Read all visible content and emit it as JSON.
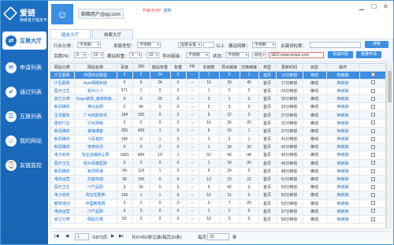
{
  "brand": {
    "name": "爱链",
    "subtitle": "换链官方指定平台"
  },
  "nav": [
    {
      "label": "互换大厅",
      "icon": "⇄",
      "active": true
    },
    {
      "label": "申请列表",
      "icon": "✉"
    },
    {
      "label": "通过列表",
      "icon": "✔"
    },
    {
      "label": "互换列表",
      "icon": "☰"
    },
    {
      "label": "我的网站",
      "icon": "⌂"
    },
    {
      "label": "友链监控",
      "icon": "⌚"
    }
  ],
  "user": {
    "email": "邮箱用户@qq.com",
    "vip_link": "升级为VIP",
    "bonus": "送购"
  },
  "tabs": [
    "链友大厅",
    "档案大厅"
  ],
  "filters": {
    "industry_label": "行业分类：",
    "industry": "不限制",
    "rank_label": "发链类型：",
    "rank": "不限制",
    "region_label": "",
    "region": "国家设置",
    "min_label": "以上",
    "outlinks_label": "搬运网数：",
    "outlinks": "不限制",
    "keyword_label": "关键词检索：",
    "keyword": "",
    "search_btn": "搜索",
    "weight_label": "百度PR：",
    "weight_from": "0",
    "weight_to": "10",
    "br_label": "搬站权重：",
    "br_from": "0",
    "br_to": "10",
    "import_label": "导出链接：",
    "import": "不限制",
    "status_label": "状态：",
    "status": "不限制",
    "site_label": "网址",
    "url_value": "SEO-www.seopz.com",
    "quick_btn": "快速匹配",
    "batch_btn": "批量申请"
  },
  "table": {
    "headers": [
      "网站分类",
      "网站名称",
      "百度",
      "360",
      "搬站权重",
      "权重",
      "PR",
      "反链数",
      "导出链接",
      "交换链接",
      "类型",
      "更新时间",
      "状态",
      "操作",
      ""
    ],
    "rows": [
      [
        "IT互联网",
        "中国商业联盟",
        "3",
        "2",
        "24",
        "0",
        "--",
        "7",
        "0",
        "1",
        "首页",
        "13分钟前",
        "离线",
        "换链接"
      ],
      [
        "IT互联网",
        "Itum网络科技",
        "0",
        "0",
        "24",
        "0",
        "--",
        "16",
        "30",
        "45",
        "首页",
        "17分钟前",
        "离线",
        "换链接"
      ],
      [
        "医疗卫生",
        "杭州人人",
        "571",
        "1",
        "0",
        "0",
        "--",
        "1",
        "0",
        "0",
        "首页",
        "23分钟前",
        "离线",
        "换链接"
      ],
      [
        "其它分类",
        "Singo装饰_装修搜索...",
        "0",
        "0",
        "25",
        "0",
        "--",
        "0",
        "1",
        "0",
        "首页",
        "25分钟前",
        "离线",
        "换链接"
      ],
      [
        "新闻媒体",
        "神马谷网",
        "2",
        "96",
        "0",
        "0",
        "--",
        "5",
        "3",
        "0",
        "首页",
        "25分钟前",
        "离线",
        "换链接"
      ],
      [
        "生活服务",
        "广州商旅资讯",
        "184",
        "155",
        "0",
        "0",
        "--",
        "9",
        "22",
        "3",
        "首页",
        "27分钟前",
        "离线",
        "换链接"
      ],
      [
        "建材行业",
        "行水网络",
        "0",
        "0",
        "0",
        "0",
        "--",
        "16",
        "36",
        "25",
        "首页",
        "31分钟前",
        "离线",
        "换链接"
      ],
      [
        "新闻媒体",
        "美柚博客",
        "355",
        "459",
        "1",
        "0",
        "--",
        "6",
        "15",
        "1",
        "首页",
        "37分钟前",
        "离线",
        "换链接"
      ],
      [
        "新闻媒体",
        "人民首府",
        "190",
        "2",
        "1",
        "0",
        "--",
        "2",
        "2",
        "1",
        "首页",
        "41分钟前",
        "离线",
        "换链接"
      ],
      [
        "新闻媒体",
        "电竞快讯",
        "0",
        "0",
        "2",
        "0",
        "--",
        "1",
        "30",
        "30",
        "首页",
        "43分钟前",
        "离线",
        "换链接"
      ],
      [
        "电子商务",
        "淘宝店铺转让网",
        "1681",
        "684",
        "14",
        "1",
        "--",
        "52",
        "66",
        "44",
        "首页",
        "43分钟前",
        "离线",
        "换链接"
      ],
      [
        "医疗卫生",
        "杭州百康医院",
        "0",
        "0",
        "0",
        "0",
        "--",
        "1",
        "30",
        "30",
        "首页",
        "45分钟前",
        "离线",
        "换链接"
      ],
      [
        "新闻媒体",
        "新闻导读",
        "64",
        "119",
        "1",
        "0",
        "--",
        "9",
        "24",
        "0",
        "首页",
        "48分钟前",
        "离线",
        "换链接"
      ],
      [
        "电商运营",
        "创客商城",
        "35",
        "105",
        "0",
        "0",
        "--",
        "13",
        "23",
        "22",
        "首页",
        "51分钟前",
        "离线",
        "换链接"
      ],
      [
        "医疗卫生",
        "IT产品网",
        "5",
        "26",
        "0",
        "0",
        "--",
        "5",
        "42",
        "0",
        "首页",
        "53分钟前",
        "离线",
        "换链接"
      ],
      [
        "电子商务",
        "淘宝优惠券",
        "109",
        "1",
        "1",
        "0",
        "--",
        "16",
        "11",
        "0",
        "首页",
        "53分钟前",
        "离线",
        "换链接"
      ],
      [
        "教育培训",
        "中国教育网",
        "3",
        "2",
        "0",
        "0",
        "--",
        "0",
        "7",
        "25",
        "首页",
        "53分钟前",
        "离线",
        "换链接"
      ],
      [
        "电商运营",
        "IT产品网",
        "6",
        "3",
        "0",
        "0",
        "--",
        "1",
        "2",
        "5",
        "首页",
        "57分钟前",
        "离线",
        "换链接"
      ],
      [
        "其它分类",
        "网站分类",
        "55",
        "0",
        "0",
        "0",
        "--",
        "16",
        "0",
        "0",
        "首页",
        "59分钟前",
        "离线",
        "换链接"
      ]
    ]
  },
  "pager": {
    "page": "1",
    "total_pages": "/2873页",
    "summary": "共57452条记录(每页20条)",
    "per_page_label": "每页",
    "per_page": "20",
    "unit": "条"
  }
}
